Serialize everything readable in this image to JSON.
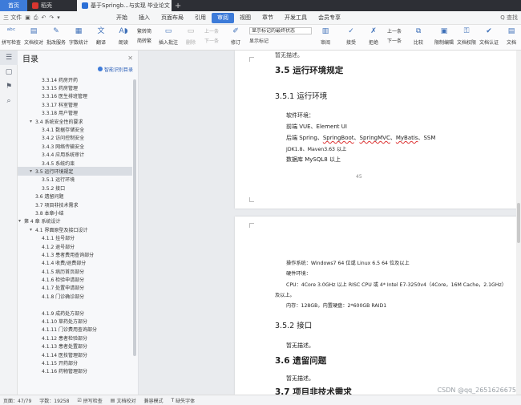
{
  "tabs": [
    {
      "label": "首页"
    },
    {
      "label": "稻壳"
    },
    {
      "label": "基于Springb...与实现 毕业论文"
    }
  ],
  "menubar": {
    "file_label": "三 文件",
    "menus": [
      "开始",
      "插入",
      "页面布局",
      "引用",
      "审阅",
      "视图",
      "章节",
      "开发工具",
      "会员专享"
    ],
    "active": "审阅",
    "search_placeholder": "Q 查找"
  },
  "ribbon": {
    "btn_spell": "拼写检查",
    "btn_doccheck": "文档校对",
    "btn_batch": "批改服务",
    "btn_wordcount": "字数统计",
    "btn_translate": "翻译",
    "btn_read": "朗读",
    "btn_trad": "繁转简",
    "btn_simp": "简转繁",
    "btn_comment": "插入批注",
    "btn_delete": "删除",
    "btn_prev": "上一条",
    "btn_next": "下一条",
    "btn_track": "修订",
    "track_state": "显示标记的最终状态",
    "show_markup": "显示标记",
    "btn_review": "审阅",
    "btn_accept": "接受",
    "btn_reject": "拒绝",
    "btn_prev2": "上一条",
    "btn_next2": "下一条",
    "btn_compare": "比较",
    "btn_restrict": "限制编辑",
    "btn_docperm": "文档权限",
    "btn_docauth": "文档认证",
    "btn_docx": "文档"
  },
  "toc": {
    "title": "目录",
    "smart_label": "智能识别目录",
    "items": [
      {
        "label": "3.3.14 药房开药",
        "level": 3
      },
      {
        "label": "3.3.15 药房管理",
        "level": 3
      },
      {
        "label": "3.3.16 医生排班管理",
        "level": 3
      },
      {
        "label": "3.3.17 科室管理",
        "level": 3
      },
      {
        "label": "3.3.18 用户管理",
        "level": 3
      },
      {
        "label": "3.4 系统安全性的要求",
        "level": 2,
        "arrow": "▾"
      },
      {
        "label": "3.4.1 数据存储安全",
        "level": 3
      },
      {
        "label": "3.4.2 访问控制安全",
        "level": 3
      },
      {
        "label": "3.4.3 网络传输安全",
        "level": 3
      },
      {
        "label": "3.4.4 应用系统审计",
        "level": 3
      },
      {
        "label": "3.4.5 系统约束",
        "level": 3
      },
      {
        "label": "3.5 运行环境规定",
        "level": 2,
        "arrow": "▾",
        "selected": true
      },
      {
        "label": "3.5.1 运行环境",
        "level": 3
      },
      {
        "label": "3.5.2 接口",
        "level": 3
      },
      {
        "label": "3.6 遗留问题",
        "level": 2
      },
      {
        "label": "3.7 项目非技术需求",
        "level": 2
      },
      {
        "label": "3.8 本章小结",
        "level": 2
      },
      {
        "label": "第 4 章   系统设计",
        "level": 1,
        "arrow": "▾"
      },
      {
        "label": "4.1 界面原型及接口设计",
        "level": 2,
        "arrow": "▾"
      },
      {
        "label": "4.1.1 挂号部分",
        "level": 3
      },
      {
        "label": "4.1.2 退号部分",
        "level": 3
      },
      {
        "label": "4.1.3 患者费用查询部分",
        "level": 3
      },
      {
        "label": "4.1.4 收费/退费部分",
        "level": 3
      },
      {
        "label": "4.1.5 病历首页部分",
        "level": 3
      },
      {
        "label": "4.1.6 检验申请部分",
        "level": 3
      },
      {
        "label": "4.1.7 处置申请部分",
        "level": 3
      },
      {
        "label": "4.1.8 门诊确诊部分",
        "level": 3
      },
      {
        "label": "",
        "level": 0
      },
      {
        "label": "4.1.9 成药处方部分",
        "level": 3
      },
      {
        "label": "4.1.10 草药处方部分",
        "level": 3
      },
      {
        "label": "4.1.11 门诊费用查询部分",
        "level": 3
      },
      {
        "label": "4.1.12 患者检验部分",
        "level": 3
      },
      {
        "label": "4.1.13 患者处置部分",
        "level": 3
      },
      {
        "label": "4.1.14 医技管理部分",
        "level": 3
      },
      {
        "label": "4.1.15 开药部分",
        "level": 3
      },
      {
        "label": "4.1.16 药物管理部分",
        "level": 3
      }
    ]
  },
  "doc": {
    "top_cut": "暂无描述。",
    "h_35": "3.5 运行环境规定",
    "h_351": "3.5.1 运行环境",
    "sw_env": "软件环境：",
    "frontend": "前端 VUE、Element UI",
    "backend_prefix": "后端 Spring、",
    "backend_sb": "SpringBoot",
    "backend_sep1": "、",
    "backend_mvc": "SpringMVC",
    "backend_sep2": "、",
    "backend_mb": "MyBatis",
    "backend_suffix": "、SSM",
    "jdk": "JDK1.8、Maven3.63 以上",
    "db": "数据库 MySQL8 以上",
    "page_no": "45",
    "os": "操作系统：Windows7 64 位或 Linux 6.5 64 位及以上",
    "hw_env": "硬件环境：",
    "cpu": "CPU：4Core 3.0GHz 以上 RISC CPU 或 4* Intel E7-3250v4（4Core，16M Cache，2.1GHz）",
    "cpu2": "及以上。",
    "mem": "内存：128GB，内置硬盘：2*600GB RAID1",
    "h_352": "3.5.2 接口",
    "none1": "暂无描述。",
    "h_36": "3.6 遗留问题",
    "none2": "暂无描述。",
    "h_37": "3.7 项目非技术需求"
  },
  "status": {
    "page": "页面：47/79",
    "words": "字数：19258",
    "spell": "拼写检查",
    "check": "文档校对",
    "compat": "兼容模式",
    "font_missing": "缺失字体"
  },
  "watermark": "CSDN @qq_2651626675"
}
